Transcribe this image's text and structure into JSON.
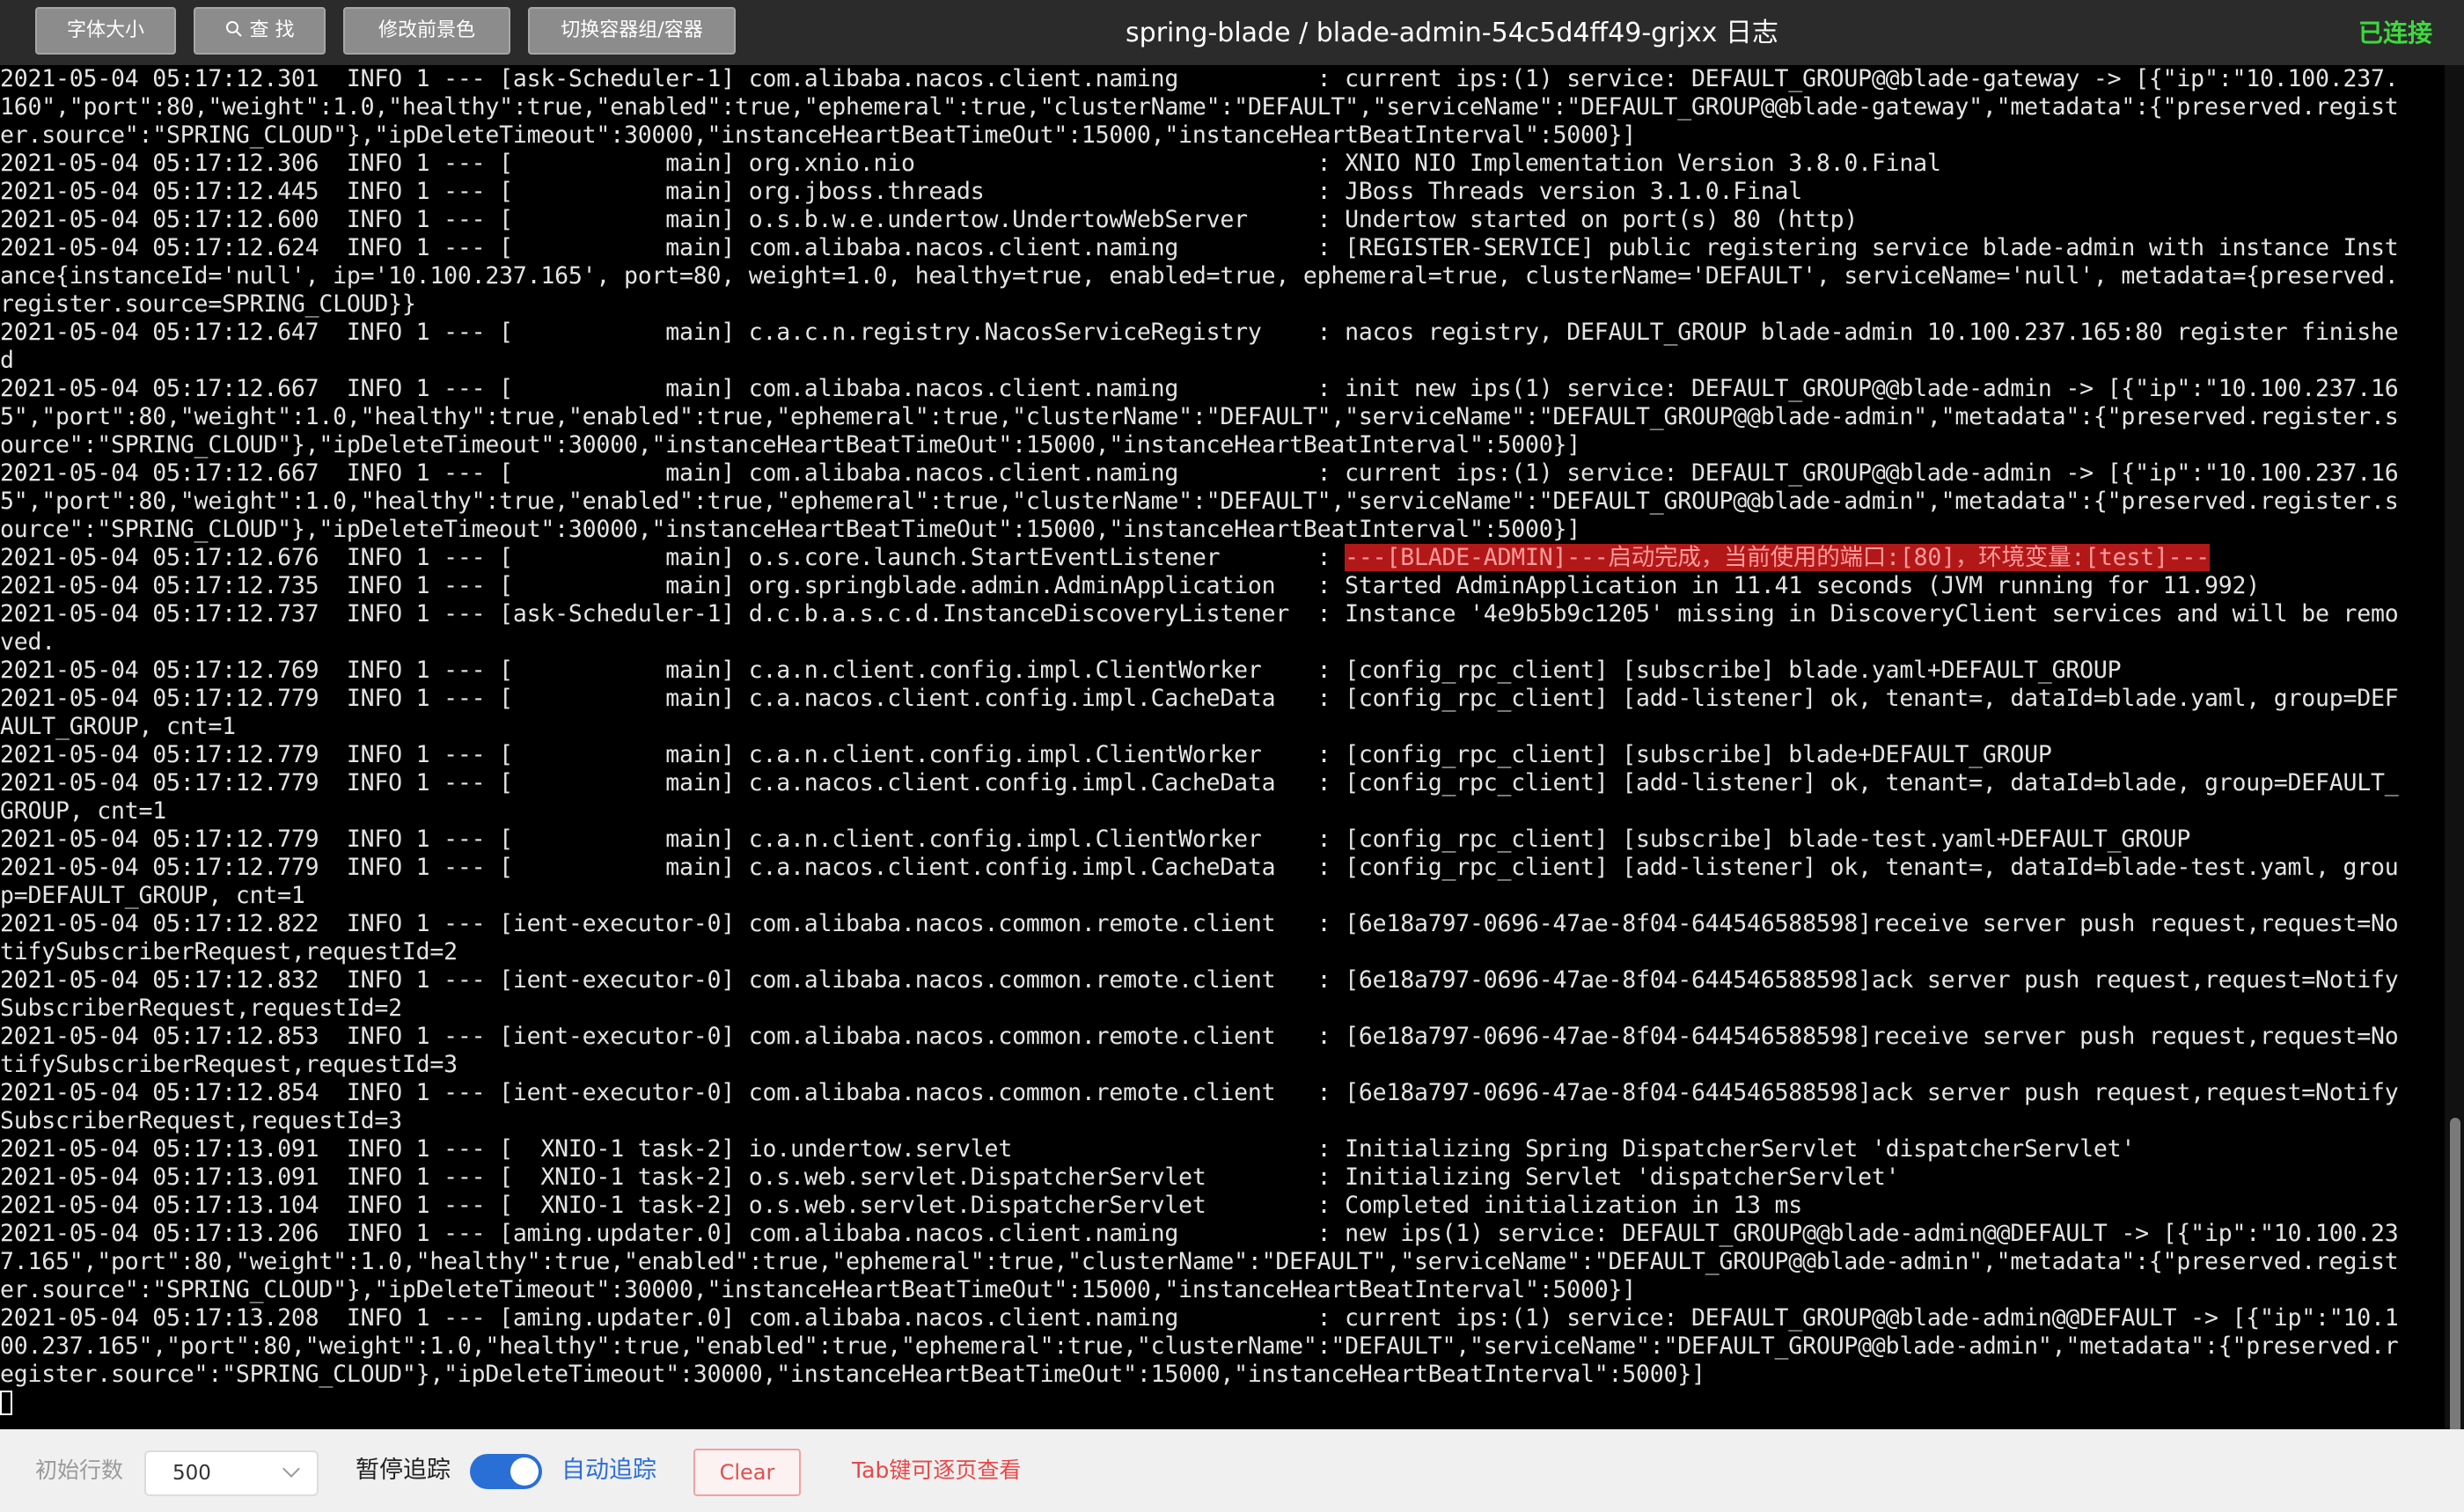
{
  "toolbar": {
    "font_size_label": "字体大小",
    "find_label": "查 找",
    "fg_color_label": "修改前景色",
    "switch_container_label": "切换容器组/容器"
  },
  "title": "spring-blade / blade-admin-54c5d4ff49-grjxx 日志",
  "connection_status": "已连接",
  "log_lines": [
    "2021-05-04 05:17:12.301  INFO 1 --- [ask-Scheduler-1] com.alibaba.nacos.client.naming          : current ips:(1) service: DEFAULT_GROUP@@blade-gateway -> [{\"ip\":\"10.100.237.",
    "160\",\"port\":80,\"weight\":1.0,\"healthy\":true,\"enabled\":true,\"ephemeral\":true,\"clusterName\":\"DEFAULT\",\"serviceName\":\"DEFAULT_GROUP@@blade-gateway\",\"metadata\":{\"preserved.regist",
    "er.source\":\"SPRING_CLOUD\"},\"ipDeleteTimeout\":30000,\"instanceHeartBeatTimeOut\":15000,\"instanceHeartBeatInterval\":5000}]",
    "2021-05-04 05:17:12.306  INFO 1 --- [           main] org.xnio.nio                             : XNIO NIO Implementation Version 3.8.0.Final",
    "2021-05-04 05:17:12.445  INFO 1 --- [           main] org.jboss.threads                        : JBoss Threads version 3.1.0.Final",
    "2021-05-04 05:17:12.600  INFO 1 --- [           main] o.s.b.w.e.undertow.UndertowWebServer     : Undertow started on port(s) 80 (http)",
    "2021-05-04 05:17:12.624  INFO 1 --- [           main] com.alibaba.nacos.client.naming          : [REGISTER-SERVICE] public registering service blade-admin with instance Inst",
    "ance{instanceId='null', ip='10.100.237.165', port=80, weight=1.0, healthy=true, enabled=true, ephemeral=true, clusterName='DEFAULT', serviceName='null', metadata={preserved.",
    "register.source=SPRING_CLOUD}}",
    "2021-05-04 05:17:12.647  INFO 1 --- [           main] c.a.c.n.registry.NacosServiceRegistry    : nacos registry, DEFAULT_GROUP blade-admin 10.100.237.165:80 register finishe",
    "d",
    "2021-05-04 05:17:12.667  INFO 1 --- [           main] com.alibaba.nacos.client.naming          : init new ips(1) service: DEFAULT_GROUP@@blade-admin -> [{\"ip\":\"10.100.237.16",
    "5\",\"port\":80,\"weight\":1.0,\"healthy\":true,\"enabled\":true,\"ephemeral\":true,\"clusterName\":\"DEFAULT\",\"serviceName\":\"DEFAULT_GROUP@@blade-admin\",\"metadata\":{\"preserved.register.s",
    "ource\":\"SPRING_CLOUD\"},\"ipDeleteTimeout\":30000,\"instanceHeartBeatTimeOut\":15000,\"instanceHeartBeatInterval\":5000}]",
    "2021-05-04 05:17:12.667  INFO 1 --- [           main] com.alibaba.nacos.client.naming          : current ips:(1) service: DEFAULT_GROUP@@blade-admin -> [{\"ip\":\"10.100.237.16",
    "5\",\"port\":80,\"weight\":1.0,\"healthy\":true,\"enabled\":true,\"ephemeral\":true,\"clusterName\":\"DEFAULT\",\"serviceName\":\"DEFAULT_GROUP@@blade-admin\",\"metadata\":{\"preserved.register.s",
    "ource\":\"SPRING_CLOUD\"},\"ipDeleteTimeout\":30000,\"instanceHeartBeatTimeOut\":15000,\"instanceHeartBeatInterval\":5000}]",
    "2021-05-04 05:17:12.676  INFO 1 --- [           main] o.s.core.launch.StartEventListener       : ",
    "2021-05-04 05:17:12.735  INFO 1 --- [           main] org.springblade.admin.AdminApplication   : Started AdminApplication in 11.41 seconds (JVM running for 11.992)",
    "2021-05-04 05:17:12.737  INFO 1 --- [ask-Scheduler-1] d.c.b.a.s.c.d.InstanceDiscoveryListener  : Instance '4e9b5b9c1205' missing in DiscoveryClient services and will be remo",
    "ved.",
    "2021-05-04 05:17:12.769  INFO 1 --- [           main] c.a.n.client.config.impl.ClientWorker    : [config_rpc_client] [subscribe] blade.yaml+DEFAULT_GROUP",
    "2021-05-04 05:17:12.779  INFO 1 --- [           main] c.a.nacos.client.config.impl.CacheData   : [config_rpc_client] [add-listener] ok, tenant=, dataId=blade.yaml, group=DEF",
    "AULT_GROUP, cnt=1",
    "2021-05-04 05:17:12.779  INFO 1 --- [           main] c.a.n.client.config.impl.ClientWorker    : [config_rpc_client] [subscribe] blade+DEFAULT_GROUP",
    "2021-05-04 05:17:12.779  INFO 1 --- [           main] c.a.nacos.client.config.impl.CacheData   : [config_rpc_client] [add-listener] ok, tenant=, dataId=blade, group=DEFAULT_",
    "GROUP, cnt=1",
    "2021-05-04 05:17:12.779  INFO 1 --- [           main] c.a.n.client.config.impl.ClientWorker    : [config_rpc_client] [subscribe] blade-test.yaml+DEFAULT_GROUP",
    "2021-05-04 05:17:12.779  INFO 1 --- [           main] c.a.nacos.client.config.impl.CacheData   : [config_rpc_client] [add-listener] ok, tenant=, dataId=blade-test.yaml, grou",
    "p=DEFAULT_GROUP, cnt=1",
    "2021-05-04 05:17:12.822  INFO 1 --- [ient-executor-0] com.alibaba.nacos.common.remote.client   : [6e18a797-0696-47ae-8f04-644546588598]receive server push request,request=No",
    "tifySubscriberRequest,requestId=2",
    "2021-05-04 05:17:12.832  INFO 1 --- [ient-executor-0] com.alibaba.nacos.common.remote.client   : [6e18a797-0696-47ae-8f04-644546588598]ack server push request,request=Notify",
    "SubscriberRequest,requestId=2",
    "2021-05-04 05:17:12.853  INFO 1 --- [ient-executor-0] com.alibaba.nacos.common.remote.client   : [6e18a797-0696-47ae-8f04-644546588598]receive server push request,request=No",
    "tifySubscriberRequest,requestId=3",
    "2021-05-04 05:17:12.854  INFO 1 --- [ient-executor-0] com.alibaba.nacos.common.remote.client   : [6e18a797-0696-47ae-8f04-644546588598]ack server push request,request=Notify",
    "SubscriberRequest,requestId=3",
    "2021-05-04 05:17:13.091  INFO 1 --- [  XNIO-1 task-2] io.undertow.servlet                      : Initializing Spring DispatcherServlet 'dispatcherServlet'",
    "2021-05-04 05:17:13.091  INFO 1 --- [  XNIO-1 task-2] o.s.web.servlet.DispatcherServlet        : Initializing Servlet 'dispatcherServlet'",
    "2021-05-04 05:17:13.104  INFO 1 --- [  XNIO-1 task-2] o.s.web.servlet.DispatcherServlet        : Completed initialization in 13 ms",
    "2021-05-04 05:17:13.206  INFO 1 --- [aming.updater.0] com.alibaba.nacos.client.naming          : new ips(1) service: DEFAULT_GROUP@@blade-admin@@DEFAULT -> [{\"ip\":\"10.100.23",
    "7.165\",\"port\":80,\"weight\":1.0,\"healthy\":true,\"enabled\":true,\"ephemeral\":true,\"clusterName\":\"DEFAULT\",\"serviceName\":\"DEFAULT_GROUP@@blade-admin\",\"metadata\":{\"preserved.regist",
    "er.source\":\"SPRING_CLOUD\"},\"ipDeleteTimeout\":30000,\"instanceHeartBeatTimeOut\":15000,\"instanceHeartBeatInterval\":5000}]",
    "2021-05-04 05:17:13.208  INFO 1 --- [aming.updater.0] com.alibaba.nacos.client.naming          : current ips:(1) service: DEFAULT_GROUP@@blade-admin@@DEFAULT -> [{\"ip\":\"10.1",
    "00.237.165\",\"port\":80,\"weight\":1.0,\"healthy\":true,\"enabled\":true,\"ephemeral\":true,\"clusterName\":\"DEFAULT\",\"serviceName\":\"DEFAULT_GROUP@@blade-admin\",\"metadata\":{\"preserved.r",
    "egister.source\":\"SPRING_CLOUD\"},\"ipDeleteTimeout\":30000,\"instanceHeartBeatTimeOut\":15000,\"instanceHeartBeatInterval\":5000}]"
  ],
  "highlight": {
    "line_index": 17,
    "text": "---[BLADE-ADMIN]---启动完成，当前使用的端口:[80]，环境变量:[test]---"
  },
  "bottom": {
    "initial_lines_label": "初始行数",
    "initial_lines_value": "500",
    "pause_label": "暂停追踪",
    "auto_label": "自动追踪",
    "auto_enabled": true,
    "clear_label": "Clear",
    "tab_hint": "Tab键可逐页查看"
  }
}
